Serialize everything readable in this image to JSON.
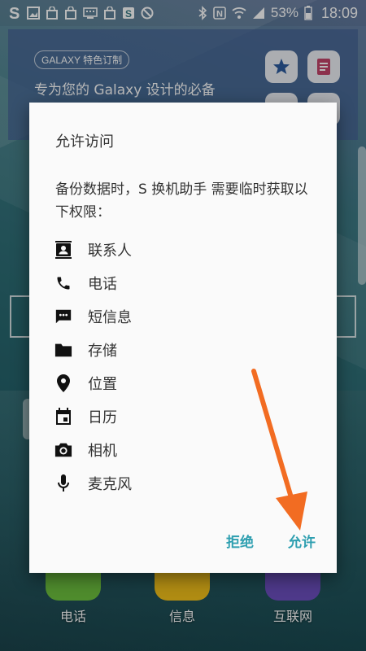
{
  "status_bar": {
    "battery_percent": "53%",
    "time": "18:09",
    "left_icons": [
      "samsung-s-icon",
      "image-icon",
      "shopping-bag-icon",
      "shopping-bag-icon",
      "keyboard-icon",
      "bag-icon",
      "s-box-icon",
      "blocked-icon"
    ],
    "right_icons": [
      "bluetooth-icon",
      "nfc-icon",
      "wifi-icon",
      "signal-icon",
      "battery-icon"
    ]
  },
  "home_widget": {
    "tag": "GALAXY 特色订制",
    "text": "专为您的 Galaxy 设计的必备"
  },
  "dock": {
    "apps": [
      {
        "label": "电话",
        "color": "#6ec23f"
      },
      {
        "label": "信息",
        "color": "#f4c21b"
      },
      {
        "label": "互联网",
        "color": "#6c4fc0"
      }
    ]
  },
  "dialog": {
    "title": "允许访问",
    "message": "备份数据时，S 换机助手 需要临时获取以下权限：",
    "permissions": [
      {
        "label": "联系人",
        "icon": "contacts-icon"
      },
      {
        "label": "电话",
        "icon": "phone-icon"
      },
      {
        "label": "短信息",
        "icon": "message-icon"
      },
      {
        "label": "存储",
        "icon": "folder-icon"
      },
      {
        "label": "位置",
        "icon": "location-icon"
      },
      {
        "label": "日历",
        "icon": "calendar-icon"
      },
      {
        "label": "相机",
        "icon": "camera-icon"
      },
      {
        "label": "麦克风",
        "icon": "microphone-icon"
      }
    ],
    "deny_label": "拒绝",
    "allow_label": "允许"
  },
  "colors": {
    "accent": "#2e9fb0",
    "arrow": "#f26c22"
  }
}
